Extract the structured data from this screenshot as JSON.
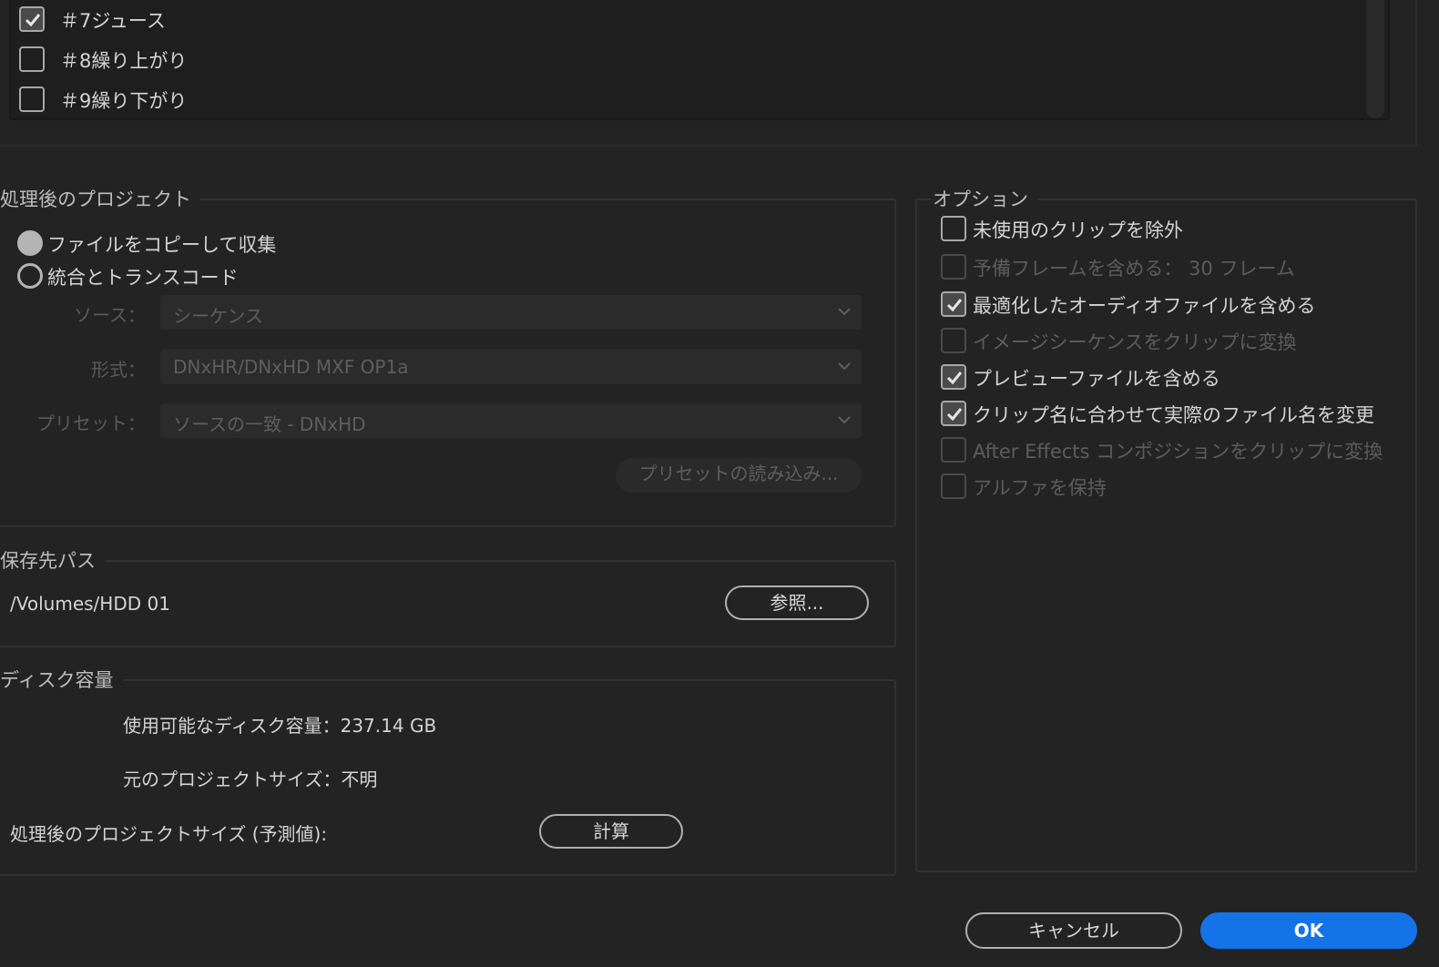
{
  "sequences": [
    {
      "label": "＃7ジュース",
      "checked": true
    },
    {
      "label": "＃8繰り上がり",
      "checked": false
    },
    {
      "label": "＃9繰り下がり",
      "checked": false
    }
  ],
  "processed_project": {
    "title": "処理後のプロジェクト",
    "radio_copy": "ファイルをコピーして収集",
    "radio_consolidate": "統合とトランスコード",
    "source_label": "ソース：",
    "source_value": "シーケンス",
    "format_label": "形式：",
    "format_value": "DNxHR/DNxHD MXF OP1a",
    "preset_label": "プリセット：",
    "preset_value": "ソースの一致 - DNxHD",
    "load_preset_button": "プリセットの読み込み..."
  },
  "destination": {
    "title": "保存先パス",
    "path": "/Volumes/HDD 01",
    "browse_button": "参照..."
  },
  "disk": {
    "title": "ディスク容量",
    "available_label": "使用可能なディスク容量：",
    "available_value": "237.14 GB",
    "original_label": "元のプロジェクトサイズ：",
    "original_value": "不明",
    "estimated_label": "処理後のプロジェクトサイズ (予測値):",
    "calculate_button": "計算"
  },
  "options": {
    "title": "オプション",
    "items": [
      {
        "label": "未使用のクリップを除外",
        "checked": false,
        "enabled": true
      },
      {
        "label": "予備フレームを含める：  30 フレーム",
        "checked": false,
        "enabled": false
      },
      {
        "label": "最適化したオーディオファイルを含める",
        "checked": true,
        "enabled": true
      },
      {
        "label": "イメージシーケンスをクリップに変換",
        "checked": false,
        "enabled": false
      },
      {
        "label": "プレビューファイルを含める",
        "checked": true,
        "enabled": true
      },
      {
        "label": "クリップ名に合わせて実際のファイル名を変更",
        "checked": true,
        "enabled": true
      },
      {
        "label": "After Effects コンポジションをクリップに変換",
        "checked": false,
        "enabled": false
      },
      {
        "label": "アルファを保持",
        "checked": false,
        "enabled": false
      }
    ]
  },
  "footer": {
    "cancel_button": "キャンセル",
    "ok_button": "OK"
  }
}
